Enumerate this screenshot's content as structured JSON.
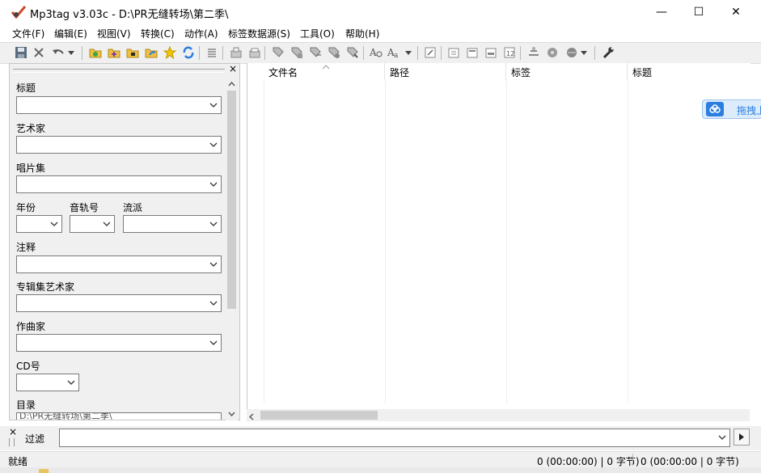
{
  "window": {
    "title": "Mp3tag v3.03c  -  D:\\PR无缝转场\\第二季\\",
    "minimize": "—",
    "maximize": "☐",
    "close": "✕"
  },
  "menu": [
    "文件(F)",
    "编辑(E)",
    "视图(V)",
    "转换(C)",
    "动作(A)",
    "标签数据源(S)",
    "工具(O)",
    "帮助(H)"
  ],
  "tagpanel": {
    "close": "×",
    "fields": {
      "title": "标题",
      "artist": "艺术家",
      "album": "唱片集",
      "year": "年份",
      "track": "音轨号",
      "genre": "流派",
      "comment": "注释",
      "album_artist": "专辑集艺术家",
      "composer": "作曲家",
      "cd": "CD号",
      "directory": "目录"
    },
    "directory_value": "D:\\PR无缝转场\\第二季\\"
  },
  "list": {
    "columns": [
      "文件名",
      "路径",
      "标签",
      "标题"
    ]
  },
  "filter": {
    "label": "过滤",
    "value": ""
  },
  "status": {
    "ready": "就绪",
    "selected": "0 (00:00:00) | 0 字节)",
    "total": "0 (00:00:00 | 0 字节)"
  },
  "overlay": {
    "baidu_text": "拖拽上"
  },
  "colors": {
    "toolbar_bg": "#f0f0f0",
    "accent_blue": "#2b7ee0",
    "star": "#f5c400"
  }
}
